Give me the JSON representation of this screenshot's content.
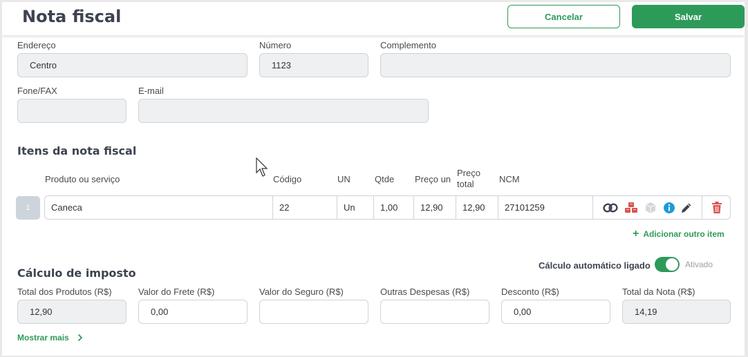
{
  "header": {
    "title": "Nota fiscal",
    "cancel_label": "Cancelar",
    "save_label": "Salvar"
  },
  "address": {
    "endereco_label": "Endereço",
    "endereco_value": "Centro",
    "numero_label": "Número",
    "numero_value": "1123",
    "complemento_label": "Complemento",
    "complemento_value": "",
    "fone_label": "Fone/FAX",
    "fone_value": "",
    "email_label": "E-mail",
    "email_value": ""
  },
  "items": {
    "title": "Itens da nota fiscal",
    "columns": [
      "Produto ou serviço",
      "Código",
      "UN",
      "Qtde",
      "Preço un",
      "Preço total",
      "NCM"
    ],
    "rows": [
      {
        "index": "1",
        "produto": "Caneca",
        "codigo": "22",
        "un": "Un",
        "qtde": "1,00",
        "preco_un": "12,90",
        "preco_total": "12,90",
        "ncm": "27101259",
        "icons": [
          "link-icon",
          "cubes-icon",
          "box-icon",
          "info-icon",
          "pencil-icon",
          "trash-icon"
        ]
      }
    ],
    "add_label": "Adicionar outro item"
  },
  "tax": {
    "title": "Cálculo de imposto",
    "auto_label": "Cálculo automático ligado",
    "auto_state": "Ativado",
    "auto_on": true,
    "fields": [
      {
        "label": "Total dos Produtos (R$)",
        "value": "12,90"
      },
      {
        "label": "Valor do Frete (R$)",
        "value": "0,00"
      },
      {
        "label": "Valor do Seguro (R$)",
        "value": ""
      },
      {
        "label": "Outras Despesas (R$)",
        "value": ""
      },
      {
        "label": "Desconto (R$)",
        "value": "0,00"
      },
      {
        "label": "Total da Nota (R$)",
        "value": "14,19"
      }
    ],
    "show_more_label": "Mostrar mais"
  },
  "colors": {
    "accent": "#2e9a5a",
    "title": "#3d4350",
    "readonly_bg": "#eef0f2"
  }
}
